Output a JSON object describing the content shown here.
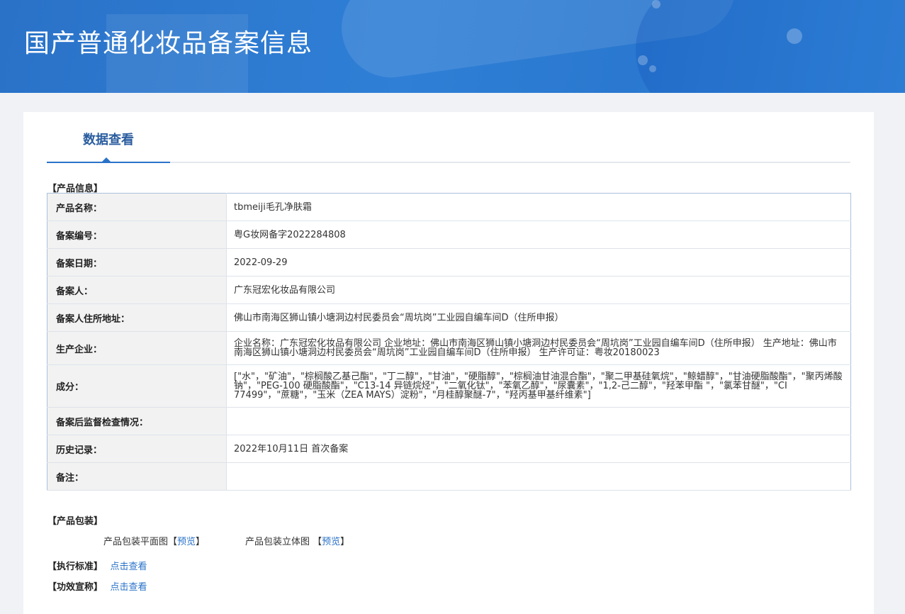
{
  "page": {
    "title": "国产普通化妆品备案信息"
  },
  "tabs": [
    {
      "label": "数据查看"
    }
  ],
  "product_info": {
    "section_label": "【产品信息】",
    "rows": [
      {
        "key": "产品名称：",
        "value": "tbmeiji毛孔净肤霜"
      },
      {
        "key": "备案编号：",
        "value": "粤G妆网备字2022284808"
      },
      {
        "key": "备案日期：",
        "value": "2022-09-29"
      },
      {
        "key": "备案人：",
        "value": "广东冠宏化妆品有限公司"
      },
      {
        "key": "备案人住所地址：",
        "value": "佛山市南海区狮山镇小塘洞边村民委员会“周坑岗”工业园自编车间D（住所申报）"
      },
      {
        "key": "生产企业：",
        "value": "企业名称：广东冠宏化妆品有限公司 企业地址：佛山市南海区狮山镇小塘洞边村民委员会“周坑岗”工业园自编车间D（住所申报） 生产地址：佛山市南海区狮山镇小塘洞边村民委员会“周坑岗”工业园自编车间D（住所申报） 生产许可证：粤妆20180023"
      },
      {
        "key": "成分：",
        "value": "[\"水\"，\"矿油\"，\"棕榈酸乙基己酯\"，\"丁二醇\"，\"甘油\"，\"硬脂醇\"，\"棕榈油甘油混合酯\"，\"聚二甲基硅氧烷\"，\"鲸蜡醇\"，\"甘油硬脂酸酯\"，\"聚丙烯酸钠\"，\"PEG-100 硬脂酸酯\"，\"C13-14 异链烷烃\"，\"二氧化钛\"，\"苯氧乙醇\"，\"尿囊素\"，\"1,2-己二醇\"，\"羟苯甲酯 \"，\"氯苯甘醚\"，\"CI 77499\"，\"蔗糖\"，\"玉米（ZEA MAYS）淀粉\"，\"月桂醇聚醚-7\"，\"羟丙基甲基纤维素\"]"
      },
      {
        "key": "备案后监督检查情况：",
        "value": ""
      },
      {
        "key": "历史记录：",
        "value": "2022年10月11日 首次备案"
      },
      {
        "key": "备注：",
        "value": ""
      }
    ]
  },
  "packaging": {
    "section_label": "【产品包装】",
    "flat_label": "产品包装平面图【",
    "flat_link": "预览",
    "flat_close": "】",
    "solid_label": "产品包装立体图 【",
    "solid_link": "预览",
    "solid_close": "】"
  },
  "standard": {
    "label": "【执行标准】",
    "link": "点击查看"
  },
  "efficacy": {
    "label": "【功效宣称】",
    "link": "点击查看"
  },
  "colors": {
    "accent": "#2a72c8",
    "banner": "#2f7fd6",
    "background": "#f0f2f5"
  }
}
